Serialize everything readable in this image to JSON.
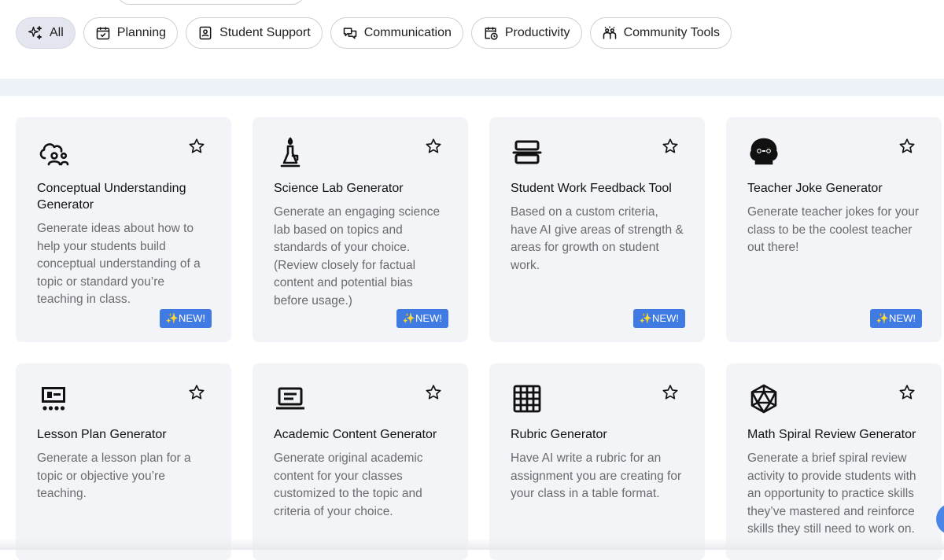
{
  "filters": [
    {
      "label": "All",
      "icon": "sparkles-icon",
      "active": true
    },
    {
      "label": "Planning",
      "icon": "calendar-check-icon",
      "active": false
    },
    {
      "label": "Student Support",
      "icon": "student-card-icon",
      "active": false
    },
    {
      "label": "Communication",
      "icon": "chat-bubbles-icon",
      "active": false
    },
    {
      "label": "Productivity",
      "icon": "calendar-clock-icon",
      "active": false
    },
    {
      "label": "Community Tools",
      "icon": "community-icon",
      "active": false
    }
  ],
  "cards": [
    {
      "title": "Conceptual Understanding Generator",
      "description": "Generate ideas about how to help your students build conceptual understanding of a topic or standard you’re teaching in class.",
      "badge": "✨NEW!",
      "icon": "cloud-people-icon"
    },
    {
      "title": "Science Lab Generator",
      "description": "Generate an engaging science lab based on topics and standards of your choice. (Review closely for factual content and potential bias before usage.)",
      "badge": "✨NEW!",
      "icon": "bunsen-burner-icon"
    },
    {
      "title": "Student Work Feedback Tool",
      "description": "Based on a custom criteria, have AI give areas of strength & areas for growth on student work.",
      "badge": "✨NEW!",
      "icon": "stacked-boxes-icon"
    },
    {
      "title": "Teacher Joke Generator",
      "description": "Generate teacher jokes for your class to be the coolest teacher out there!",
      "badge": "✨NEW!",
      "icon": "joke-face-icon"
    },
    {
      "title": "Lesson Plan Generator",
      "description": "Generate a lesson plan for a topic or objective you’re teaching.",
      "badge": "",
      "icon": "presentation-icon"
    },
    {
      "title": "Academic Content Generator",
      "description": "Generate original academic content for your classes customized to the topic and criteria of your choice.",
      "badge": "",
      "icon": "laptop-icon"
    },
    {
      "title": "Rubric Generator",
      "description": "Have AI write a rubric for an assignment you are creating for your class in a table format.",
      "badge": "",
      "icon": "grid-table-icon"
    },
    {
      "title": "Math Spiral Review Generator",
      "description": "Generate a brief spiral review activity to provide students with an opportunity to practice skills they’ve mastered and reinforce skills they still need to work on.",
      "badge": "",
      "icon": "polyhedron-icon"
    }
  ],
  "colors": {
    "badge": "#3f7be2",
    "card_bg": "#f3f4f7",
    "active_chip": "#e3e6ee"
  }
}
